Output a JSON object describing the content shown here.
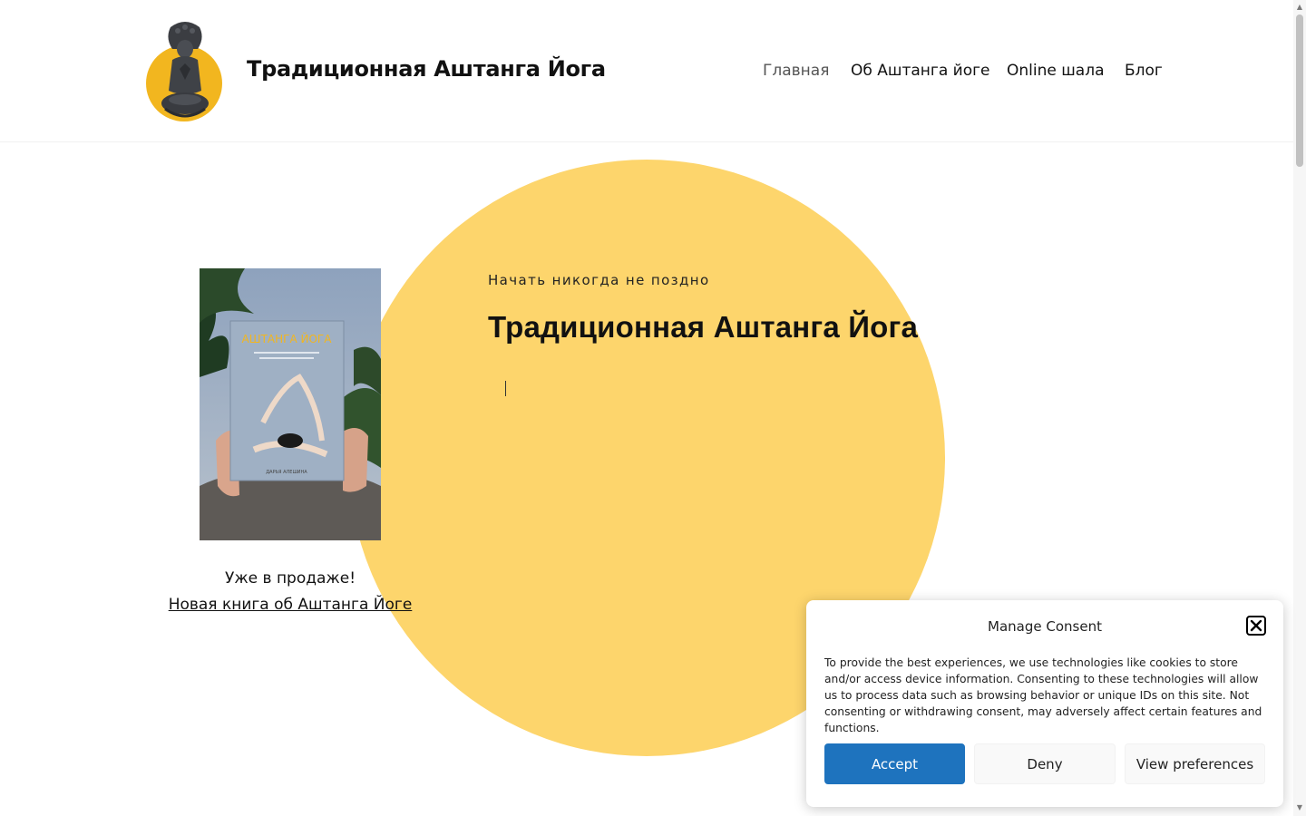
{
  "header": {
    "site_title": "Традиционная Аштанга Йога",
    "nav": [
      {
        "label": "Главная",
        "active": true
      },
      {
        "label": "Об Аштанга йоге",
        "active": false
      },
      {
        "label": "Online шала",
        "active": false
      },
      {
        "label": "Блог",
        "active": false
      }
    ]
  },
  "hero": {
    "kicker": "Начать никогда не поздно",
    "title": "Традиционная Аштанга Йога",
    "book": {
      "cover_title": "АШТАНГА ЙОГА",
      "cover_author": "ДАРЬЯ АЛЕШИНА",
      "sale_text": "Уже в продаже!",
      "link_text": "Новая книга об Аштанга Йоге"
    }
  },
  "consent": {
    "title": "Manage Consent",
    "body": "To provide the best experiences, we use technologies like cookies to store and/or access device information. Consenting to these technologies will allow us to process data such as browsing behavior or unique IDs on this site. Not consenting or withdrawing consent, may adversely affect certain features and functions.",
    "accept": "Accept",
    "deny": "Deny",
    "preferences": "View preferences"
  },
  "colors": {
    "accent_circle": "#fdd56c",
    "accept_button": "#1e73be"
  }
}
